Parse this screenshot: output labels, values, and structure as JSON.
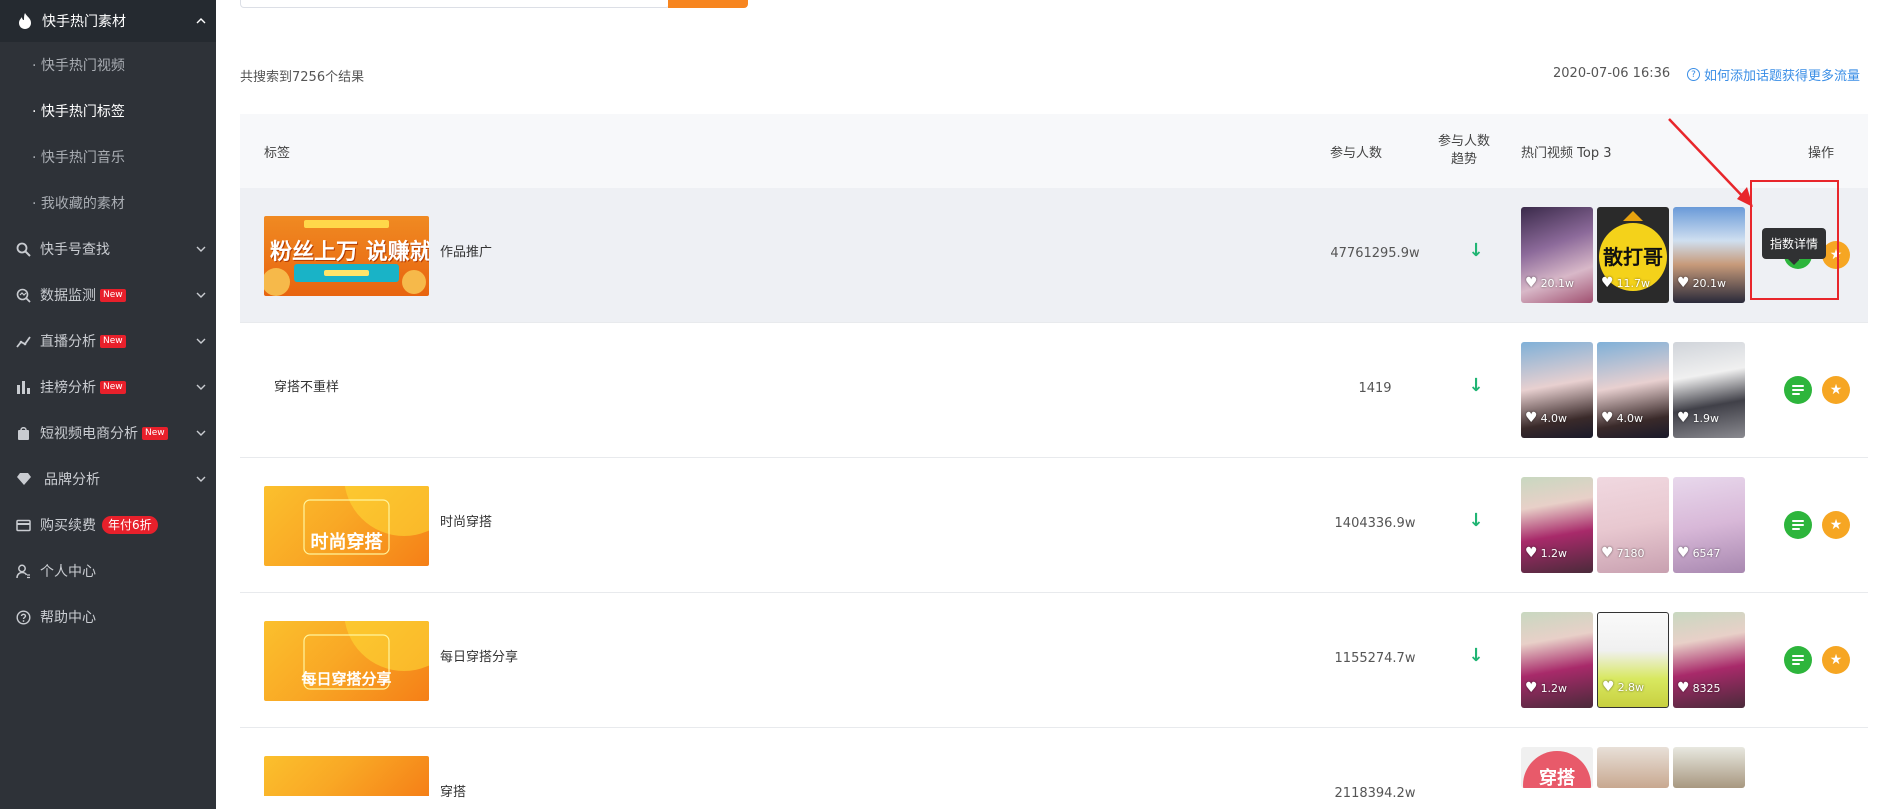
{
  "sidebar": {
    "top": {
      "label": "快手热门素材"
    },
    "subs": [
      {
        "label": "· 快手热门视频"
      },
      {
        "label": "· 快手热门标签"
      },
      {
        "label": "· 快手热门音乐"
      },
      {
        "label": "· 我收藏的素材"
      }
    ],
    "items": [
      {
        "label": "快手号查找"
      },
      {
        "label": "数据监测",
        "badge": "New"
      },
      {
        "label": "直播分析",
        "badge": "New"
      },
      {
        "label": "挂榜分析",
        "badge": "New"
      },
      {
        "label": "短视频电商分析",
        "badge": "New"
      },
      {
        "label": "品牌分析"
      },
      {
        "label": "购买续费",
        "promo": "年付6折"
      },
      {
        "label": "个人中心"
      },
      {
        "label": "帮助中心"
      }
    ]
  },
  "header": {
    "result_count": "共搜索到7256个结果",
    "date": "2020-07-06 16:36",
    "help_link": "如何添加话题获得更多流量"
  },
  "table": {
    "columns": {
      "tag": "标签",
      "participants": "参与人数",
      "trend_line1": "参与人数",
      "trend_line2": "趋势",
      "top3": "热门视频 Top 3",
      "actions": "操作"
    },
    "rows": [
      {
        "tag": "作品推广",
        "image_text": "粉丝上万 说赚就赚",
        "participants": "47761295.9w",
        "trend": "↓",
        "likes": [
          "20.1w",
          "11.7w",
          "20.1w"
        ]
      },
      {
        "tag": "穿搭不重样",
        "image_text": "",
        "participants": "1419",
        "trend": "↓",
        "likes": [
          "4.0w",
          "4.0w",
          "1.9w"
        ]
      },
      {
        "tag": "时尚穿搭",
        "image_text": "时尚穿搭",
        "participants": "1404336.9w",
        "trend": "↓",
        "likes": [
          "1.2w",
          "7180",
          "6547"
        ]
      },
      {
        "tag": "每日穿搭分享",
        "image_text": "每日穿搭分享",
        "participants": "1155274.7w",
        "trend": "↓",
        "likes": [
          "1.2w",
          "2.8w",
          "8325"
        ]
      },
      {
        "tag": "穿搭",
        "image_text": "",
        "participants": "2118394.2w",
        "trend": "↓",
        "likes": [
          "",
          "",
          ""
        ]
      }
    ],
    "video_second_text": "散打哥",
    "last_vid_text": "穿搭"
  },
  "tooltip": "指数详情",
  "colors": {
    "accent": "#f7851f",
    "sidebar": "#2e3238",
    "trend": "#21b574",
    "detail": "#2db53c",
    "fav": "#f6a623",
    "annotation": "#e8262b"
  }
}
